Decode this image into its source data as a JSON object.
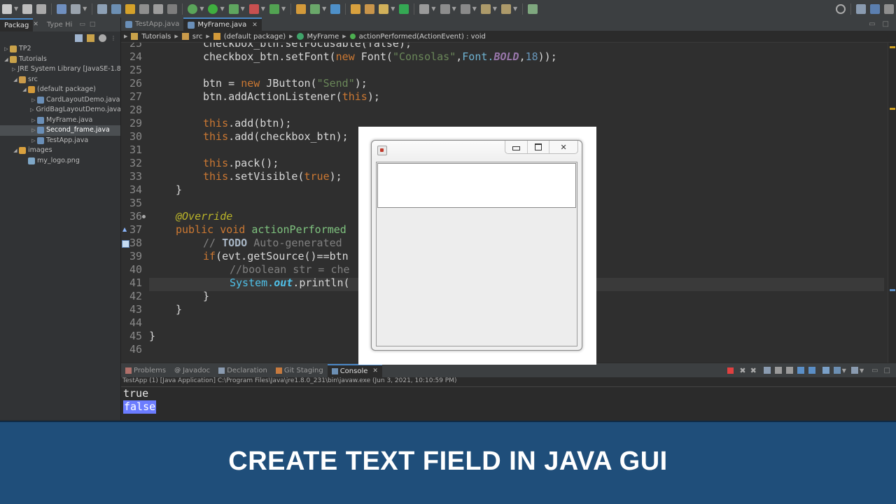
{
  "editor": {
    "tabs": [
      {
        "label": "TestApp.java",
        "active": false
      },
      {
        "label": "MyFrame.java",
        "active": true
      }
    ],
    "breadcrumb": [
      "Tutorials",
      "src",
      "(default package)",
      "MyFrame",
      "actionPerformed(ActionEvent) : void"
    ],
    "line_numbers": [
      "25",
      "24",
      "25",
      "26",
      "27",
      "28",
      "29",
      "30",
      "31",
      "32",
      "33",
      "34",
      "35",
      "36",
      "37",
      "38",
      "39",
      "40",
      "41",
      "42",
      "43",
      "44",
      "45",
      "46"
    ],
    "code": {
      "l25_partial": "checkbox_btn.setFocusable(false);",
      "l24": {
        "a": "checkbox_btn.setFont(",
        "b": "new",
        "c": " Font(",
        "d": "\"Consolas\"",
        "e": ",",
        "f": "Font.",
        "g": "BOLD",
        "h": ",",
        "i": "18",
        "j": "));"
      },
      "l26": {
        "a": "btn = ",
        "b": "new",
        "c": " JButton(",
        "d": "\"Send\"",
        "e": ");"
      },
      "l27": {
        "a": "btn.addActionListener(",
        "b": "this",
        "c": ");"
      },
      "l29": {
        "a": "this",
        "b": ".add(btn);"
      },
      "l30": {
        "a": "this",
        "b": ".add(checkbox_btn);"
      },
      "l32": {
        "a": "this",
        "b": ".pack();"
      },
      "l33": {
        "a": "this",
        "b": ".setVisible(",
        "c": "true",
        "d": ");"
      },
      "l34": "}",
      "l36": "@Override",
      "l37": {
        "a": "public",
        "b": " ",
        "c": "void",
        "d": " ",
        "e": "actionPerformed"
      },
      "l38": {
        "a": "// ",
        "b": "TODO",
        "c": " Auto-generated "
      },
      "l39": {
        "a": "if",
        "b": "(evt.getSource()==btn"
      },
      "l40": "//boolean str = che",
      "l41": {
        "a": "System.",
        "b": "out",
        "c": ".println("
      },
      "l42": "}",
      "l43": "}",
      "l45": "}"
    }
  },
  "explorer": {
    "tabs": [
      {
        "label": "Packag",
        "active": true
      },
      {
        "label": "Type Hi",
        "active": false
      }
    ],
    "tree": [
      {
        "label": "TP2",
        "depth": 0,
        "arrow": "▷"
      },
      {
        "label": "Tutorials",
        "depth": 0,
        "arrow": "◢"
      },
      {
        "label": "JRE System Library [JavaSE-1.8",
        "depth": 1,
        "arrow": "▷"
      },
      {
        "label": "src",
        "depth": 1,
        "arrow": "◢"
      },
      {
        "label": "(default package)",
        "depth": 2,
        "arrow": "◢"
      },
      {
        "label": "CardLayoutDemo.java",
        "depth": 3,
        "arrow": "▷"
      },
      {
        "label": "GridBagLayoutDemo.java",
        "depth": 3,
        "arrow": "▷"
      },
      {
        "label": "MyFrame.java",
        "depth": 3,
        "arrow": "▷"
      },
      {
        "label": "Second_frame.java",
        "depth": 3,
        "arrow": "▷",
        "selected": true
      },
      {
        "label": "TestApp.java",
        "depth": 3,
        "arrow": "▷"
      },
      {
        "label": "images",
        "depth": 1,
        "arrow": "◢"
      },
      {
        "label": "my_logo.png",
        "depth": 2,
        "arrow": ""
      }
    ]
  },
  "console": {
    "tabs": [
      {
        "label": "Problems",
        "active": false
      },
      {
        "label": "Javadoc",
        "active": false
      },
      {
        "label": "Declaration",
        "active": false
      },
      {
        "label": "Git Staging",
        "active": false
      },
      {
        "label": "Console",
        "active": true
      }
    ],
    "info": "TestApp (1) [Java Application] C:\\Program Files\\Java\\jre1.8.0_231\\bin\\javaw.exe (Jun 3, 2021, 10:10:59 PM)",
    "lines": [
      "true",
      "false"
    ]
  },
  "banner": {
    "title": "CREATE TEXT FIELD IN JAVA GUI"
  },
  "colors": {
    "banner": "#1f4e7a",
    "editor_bg": "#2f2f2f",
    "keyword": "#cc7832",
    "string": "#6a8759"
  }
}
